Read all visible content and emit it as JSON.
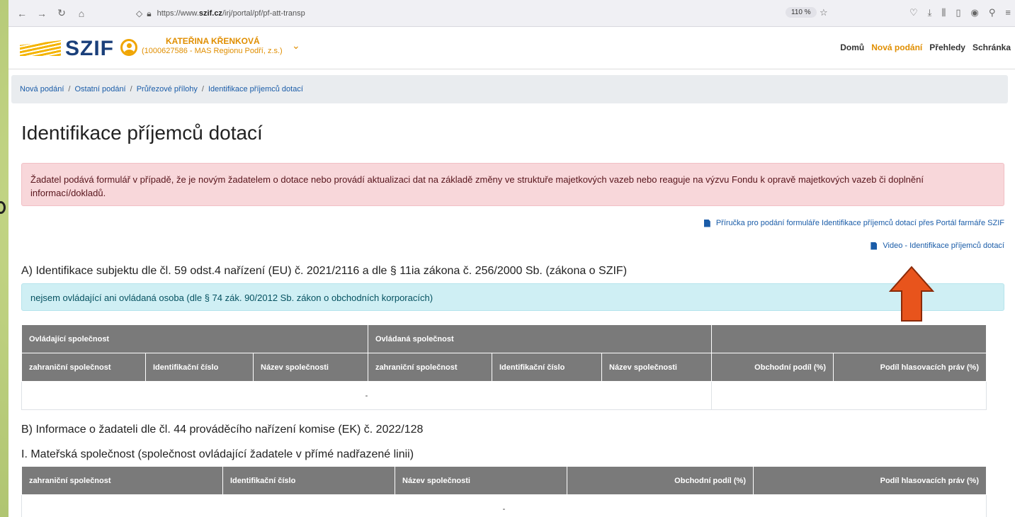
{
  "browser": {
    "url_prefix": "https://www.",
    "url_domain": "szif.cz",
    "url_path": "/irj/portal/pf/pf-att-transp",
    "zoom": "110 %"
  },
  "header": {
    "logo": "SZIF",
    "user_name": "KATEŘINA KŘENKOVÁ",
    "user_sub": "(1000627586 - MAS Regionu Podří, z.s.)",
    "nav": [
      "Domů",
      "Nová podání",
      "Přehledy",
      "Schránka"
    ]
  },
  "breadcrumb": [
    "Nová podání",
    "Ostatní podání",
    "Průřezové přílohy",
    "Identifikace příjemců dotací"
  ],
  "page": {
    "title": "Identifikace příjemců dotací",
    "alert": "Žadatel podává formulář v případě, že je novým žadatelem o dotace nebo provádí aktualizaci dat na základě změny ve struktuře majetkových vazeb nebo reaguje na výzvu Fondu k opravě majetkových vazeb či doplnění informací/dokladů.",
    "link_guide": "Příručka pro podání formuláře Identifikace příjemců dotací přes Portál farmáře SZIF",
    "link_video": "Video - Identifikace příjemců dotací",
    "section_a": "A) Identifikace subjektu dle čl. 59 odst.4 nařízení (EU) č. 2021/2116 a dle § 11ia zákona č. 256/2000 Sb. (zákona o SZIF)",
    "info": "nejsem ovládající ani ovládaná osoba (dle § 74 zák. 90/2012 Sb. zákon o obchodních korporacích)",
    "section_b": "B) Informace o žadateli dle čl. 44 prováděcího nařízení komise (EK) č. 2022/128",
    "section_b1": "I. Mateřská společnost (společnost ovládající žadatele v přímé nadřazené linii)"
  },
  "table1": {
    "group_headers": [
      "Ovládající společnost",
      "Ovládaná společnost",
      ""
    ],
    "columns": [
      "zahraniční společnost",
      "Identifikační číslo",
      "Název společnosti",
      "zahraniční společnost",
      "Identifikační číslo",
      "Název společnosti",
      "Obchodní podíl (%)",
      "Podíl hlasovacích práv (%)"
    ],
    "empty": "-"
  },
  "table2": {
    "columns": [
      "zahraniční společnost",
      "Identifikační číslo",
      "Název společnosti",
      "Obchodní podíl (%)",
      "Podíl hlasovacích práv (%)"
    ],
    "empty": "-"
  }
}
